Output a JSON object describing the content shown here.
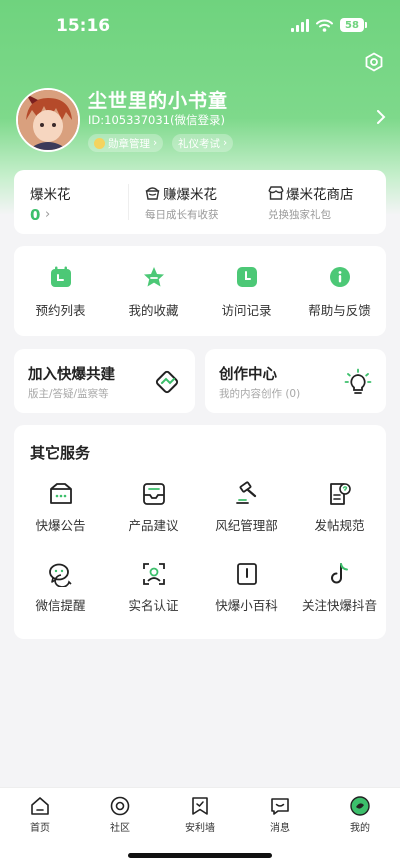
{
  "status": {
    "time": "15:16",
    "battery": "58"
  },
  "profile": {
    "username": "尘世里的小书童",
    "user_id": "ID:105337031(微信登录)",
    "tags": [
      "勋章管理",
      "礼仪考试"
    ]
  },
  "points": {
    "popcorn": {
      "title": "爆米花",
      "value": "0",
      "arrow": "›"
    },
    "earn": {
      "title": "赚爆米花",
      "subtitle": "每日成长有收获"
    },
    "shop": {
      "title": "爆米花商店",
      "subtitle": "兑换独家礼包"
    }
  },
  "quick_actions": [
    "预约列表",
    "我的收藏",
    "访问记录",
    "帮助与反馈"
  ],
  "features": {
    "join": {
      "title": "加入快爆共建",
      "subtitle": "版主/答疑/监察等"
    },
    "create": {
      "title": "创作中心",
      "subtitle": "我的内容创作 (0)"
    }
  },
  "services": {
    "title": "其它服务",
    "items": [
      "快爆公告",
      "产品建议",
      "风纪管理部",
      "发帖规范",
      "微信提醒",
      "实名认证",
      "快爆小百科",
      "关注快爆抖音"
    ]
  },
  "tabs": [
    "首页",
    "社区",
    "安利墙",
    "消息",
    "我的"
  ],
  "colors": {
    "accent": "#3cbf6b",
    "header": "#6fd37e"
  }
}
